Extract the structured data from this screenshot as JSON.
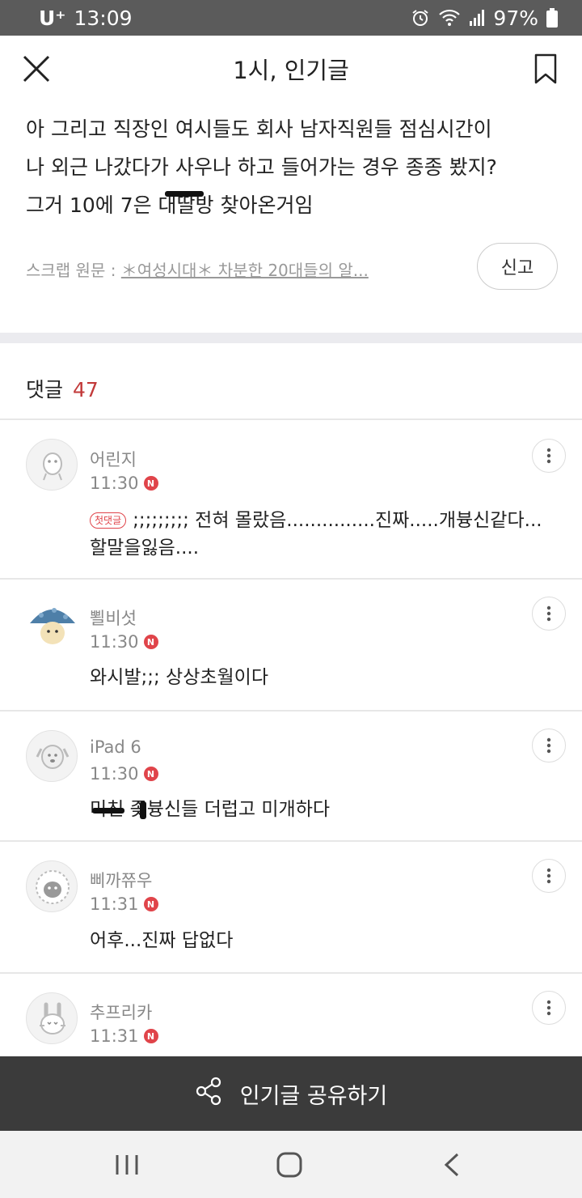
{
  "status_bar": {
    "carrier": "U⁺",
    "time": "13:09",
    "battery": "97%"
  },
  "header": {
    "title": "1시, 인기글"
  },
  "article": {
    "text": "아 그리고 직장인 여시들도 회사 남자직원들 점심시간이\n나 외근 나갔다가 사우나 하고 들어가는 경우 종종 봤지?\n그거 10에 7은 대딸방 찾아온거임",
    "scrap_label": "스크랩 원문 :",
    "scrap_link": "＊여성시대＊ 차분한 20대들의 알...",
    "report_label": "신고"
  },
  "comments_header": {
    "label": "댓글",
    "count": "47"
  },
  "comments": [
    {
      "nick": "어린지",
      "time": "11:30",
      "new_badge": "N",
      "first_badge": "첫댓글",
      "text": ";;;;;;;;; 전혀 몰랐음...............진짜.....개븅신같다... 할말을잃음....",
      "avatar": "ghost-avatar"
    },
    {
      "nick": "뾜비섯",
      "time": "11:30",
      "new_badge": "N",
      "text": "와시발;;; 상상초월이다",
      "avatar": "mushroom-avatar"
    },
    {
      "nick": "iPad 6",
      "time": "11:30",
      "new_badge": "N",
      "text": "미친 좆븅신들 더럽고 미개하다",
      "avatar": "dog-avatar"
    },
    {
      "nick": "삐까쮸우",
      "time": "11:31",
      "new_badge": "N",
      "text": "어후...진짜 답없다",
      "avatar": "sheep-avatar"
    },
    {
      "nick": "추프리카",
      "time": "11:31",
      "new_badge": "N",
      "text": "",
      "avatar": "rabbit-avatar"
    }
  ],
  "share_bar": {
    "label": "인기글 공유하기"
  },
  "colors": {
    "accent_red": "#e0444a",
    "count_red": "#c23a3a",
    "share_bar_bg": "#3b3b3b",
    "status_bar_bg": "#5b5b5b"
  }
}
